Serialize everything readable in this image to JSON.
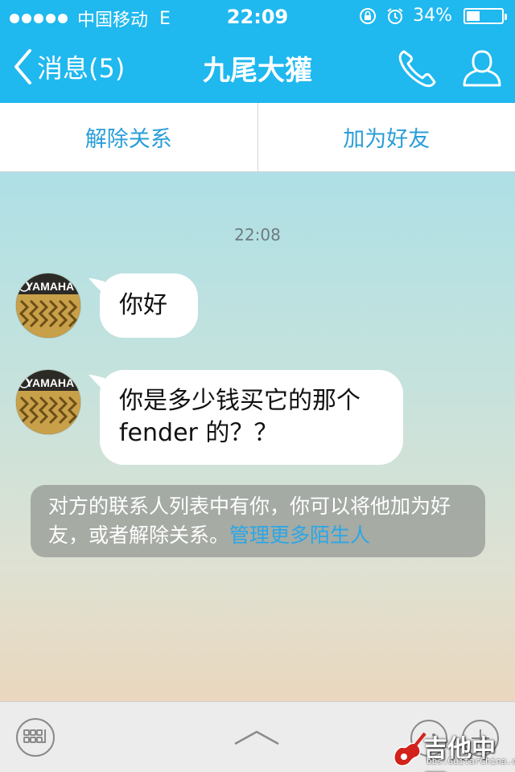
{
  "status_bar": {
    "carrier": "中国移动",
    "network": "E",
    "time": "22:09",
    "battery": "34%",
    "battery_level": 0.34
  },
  "nav": {
    "back_label": "消息(5)",
    "title": "九尾大獾",
    "phone_icon": "phone-icon",
    "contact_icon": "contact-icon"
  },
  "actions": {
    "remove_relation": "解除关系",
    "add_friend": "加为好友"
  },
  "chat": {
    "timestamp": "22:08",
    "avatar_brand": "YAMAHA",
    "messages": [
      {
        "text": "你好"
      },
      {
        "line1": "你是多少钱买它的那个",
        "line2": "fender 的？？"
      }
    ],
    "notice": {
      "text_line1": "对方的联系人列表中有你，你可以将他加为好",
      "text_line2": "友，或者解除关系。",
      "link": "管理更多陌生人"
    }
  },
  "watermark": {
    "text": "吉他中国",
    "url": "bbs.GuitarChina.com"
  },
  "colors": {
    "header_bg": "#1fb8ef",
    "accent": "#2a9ed8",
    "link": "#2aa7e6"
  }
}
